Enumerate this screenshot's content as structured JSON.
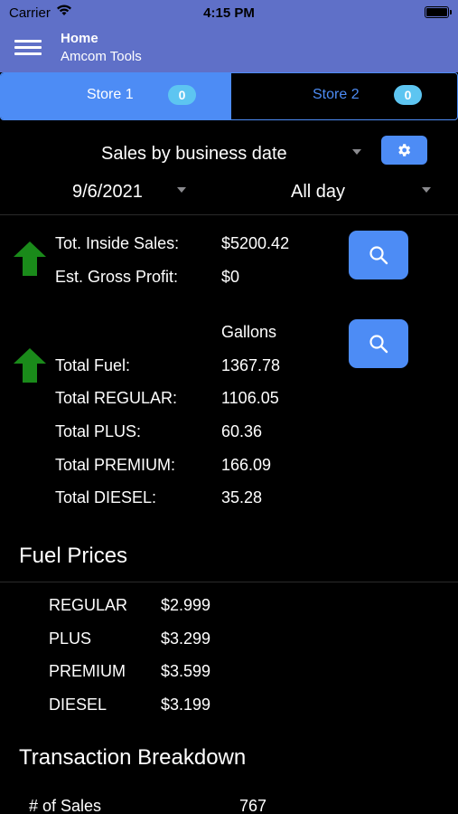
{
  "status_bar": {
    "carrier": "Carrier",
    "time": "4:15 PM"
  },
  "nav": {
    "title": "Home",
    "subtitle": "Amcom Tools"
  },
  "tabs": [
    {
      "label": "Store 1",
      "badge": "0",
      "selected": true
    },
    {
      "label": "Store 2",
      "badge": "0",
      "selected": false
    }
  ],
  "filters": {
    "report": "Sales by business date",
    "date": "9/6/2021",
    "period": "All day"
  },
  "sales": {
    "inside_label": "Tot. Inside Sales:",
    "inside_value": "$5200.42",
    "profit_label": "Est. Gross Profit:",
    "profit_value": "$0"
  },
  "fuel": {
    "unit_header": "Gallons",
    "total_label": "Total Fuel:",
    "total_value": "1367.78",
    "grades": [
      {
        "label": "Total REGULAR:",
        "value": "1106.05"
      },
      {
        "label": "Total PLUS:",
        "value": "60.36"
      },
      {
        "label": "Total PREMIUM:",
        "value": "166.09"
      },
      {
        "label": "Total DIESEL:",
        "value": "35.28"
      }
    ]
  },
  "fuel_prices": {
    "title": "Fuel Prices",
    "items": [
      {
        "grade": "REGULAR",
        "price": "$2.999"
      },
      {
        "grade": "PLUS",
        "price": "$3.299"
      },
      {
        "grade": "PREMIUM",
        "price": "$3.599"
      },
      {
        "grade": "DIESEL",
        "price": "$3.199"
      }
    ]
  },
  "transactions": {
    "title": "Transaction Breakdown",
    "rows": [
      {
        "label": "# of Sales",
        "value": "767"
      }
    ]
  },
  "colors": {
    "navbar": "#5f70c8",
    "accent": "#4d8cf5",
    "badge": "#5dc5f1",
    "trend_up": "#1a8a1a"
  }
}
